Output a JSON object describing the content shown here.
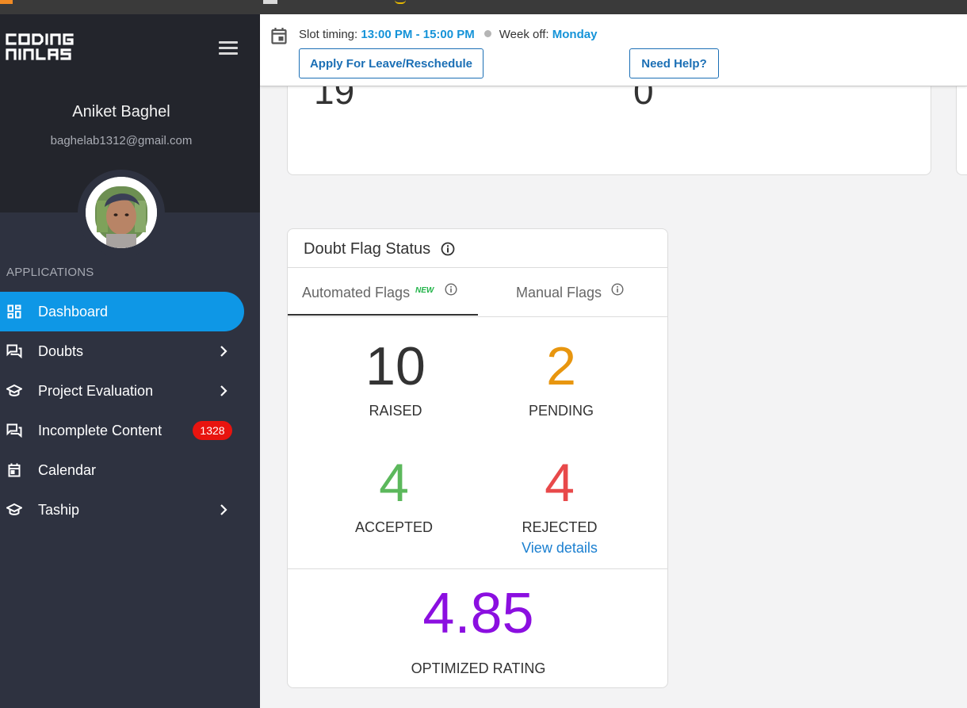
{
  "sidebar": {
    "logo_alt": "Coding Ninjas",
    "user_name": "Aniket Baghel",
    "user_email": "baghelab1312@gmail.com",
    "section_label": "APPLICATIONS",
    "items": [
      {
        "label": "Dashboard",
        "icon": "dashboard-icon",
        "active": true
      },
      {
        "label": "Doubts",
        "icon": "chat-icon",
        "chevron": true
      },
      {
        "label": "Project Evaluation",
        "icon": "graduation-cap-icon",
        "chevron": true
      },
      {
        "label": "Incomplete Content",
        "icon": "chat-icon",
        "badge": "1328"
      },
      {
        "label": "Calendar",
        "icon": "calendar-icon"
      },
      {
        "label": "Taship",
        "icon": "graduation-cap-icon",
        "chevron": true
      }
    ],
    "active_color": "#0e97e6",
    "badge_color": "#e8140f"
  },
  "header": {
    "slot_label": "Slot timing:",
    "slot_value": "13:00 PM - 15:00 PM",
    "weekoff_label": "Week off:",
    "weekoff_value": "Monday",
    "leave_button": "Apply For Leave/Reschedule",
    "help_button": "Need Help?"
  },
  "summary": {
    "left_value": "19",
    "right_value": "0"
  },
  "doubt_flags": {
    "title": "Doubt Flag Status",
    "tabs": [
      {
        "label": "Automated Flags",
        "tag": "NEW",
        "active": true
      },
      {
        "label": "Manual Flags"
      }
    ],
    "raised": {
      "value": "10",
      "label": "RAISED",
      "color": "#333333"
    },
    "pending": {
      "value": "2",
      "label": "PENDING",
      "color": "#e8960f"
    },
    "accepted": {
      "value": "4",
      "label": "ACCEPTED",
      "color": "#5cb85c"
    },
    "rejected": {
      "value": "4",
      "label": "REJECTED",
      "color": "#e8494a"
    },
    "view_details": "View details",
    "rating_value": "4.85",
    "rating_label": "OPTIMIZED RATING",
    "rating_color": "#8b0fe0"
  }
}
